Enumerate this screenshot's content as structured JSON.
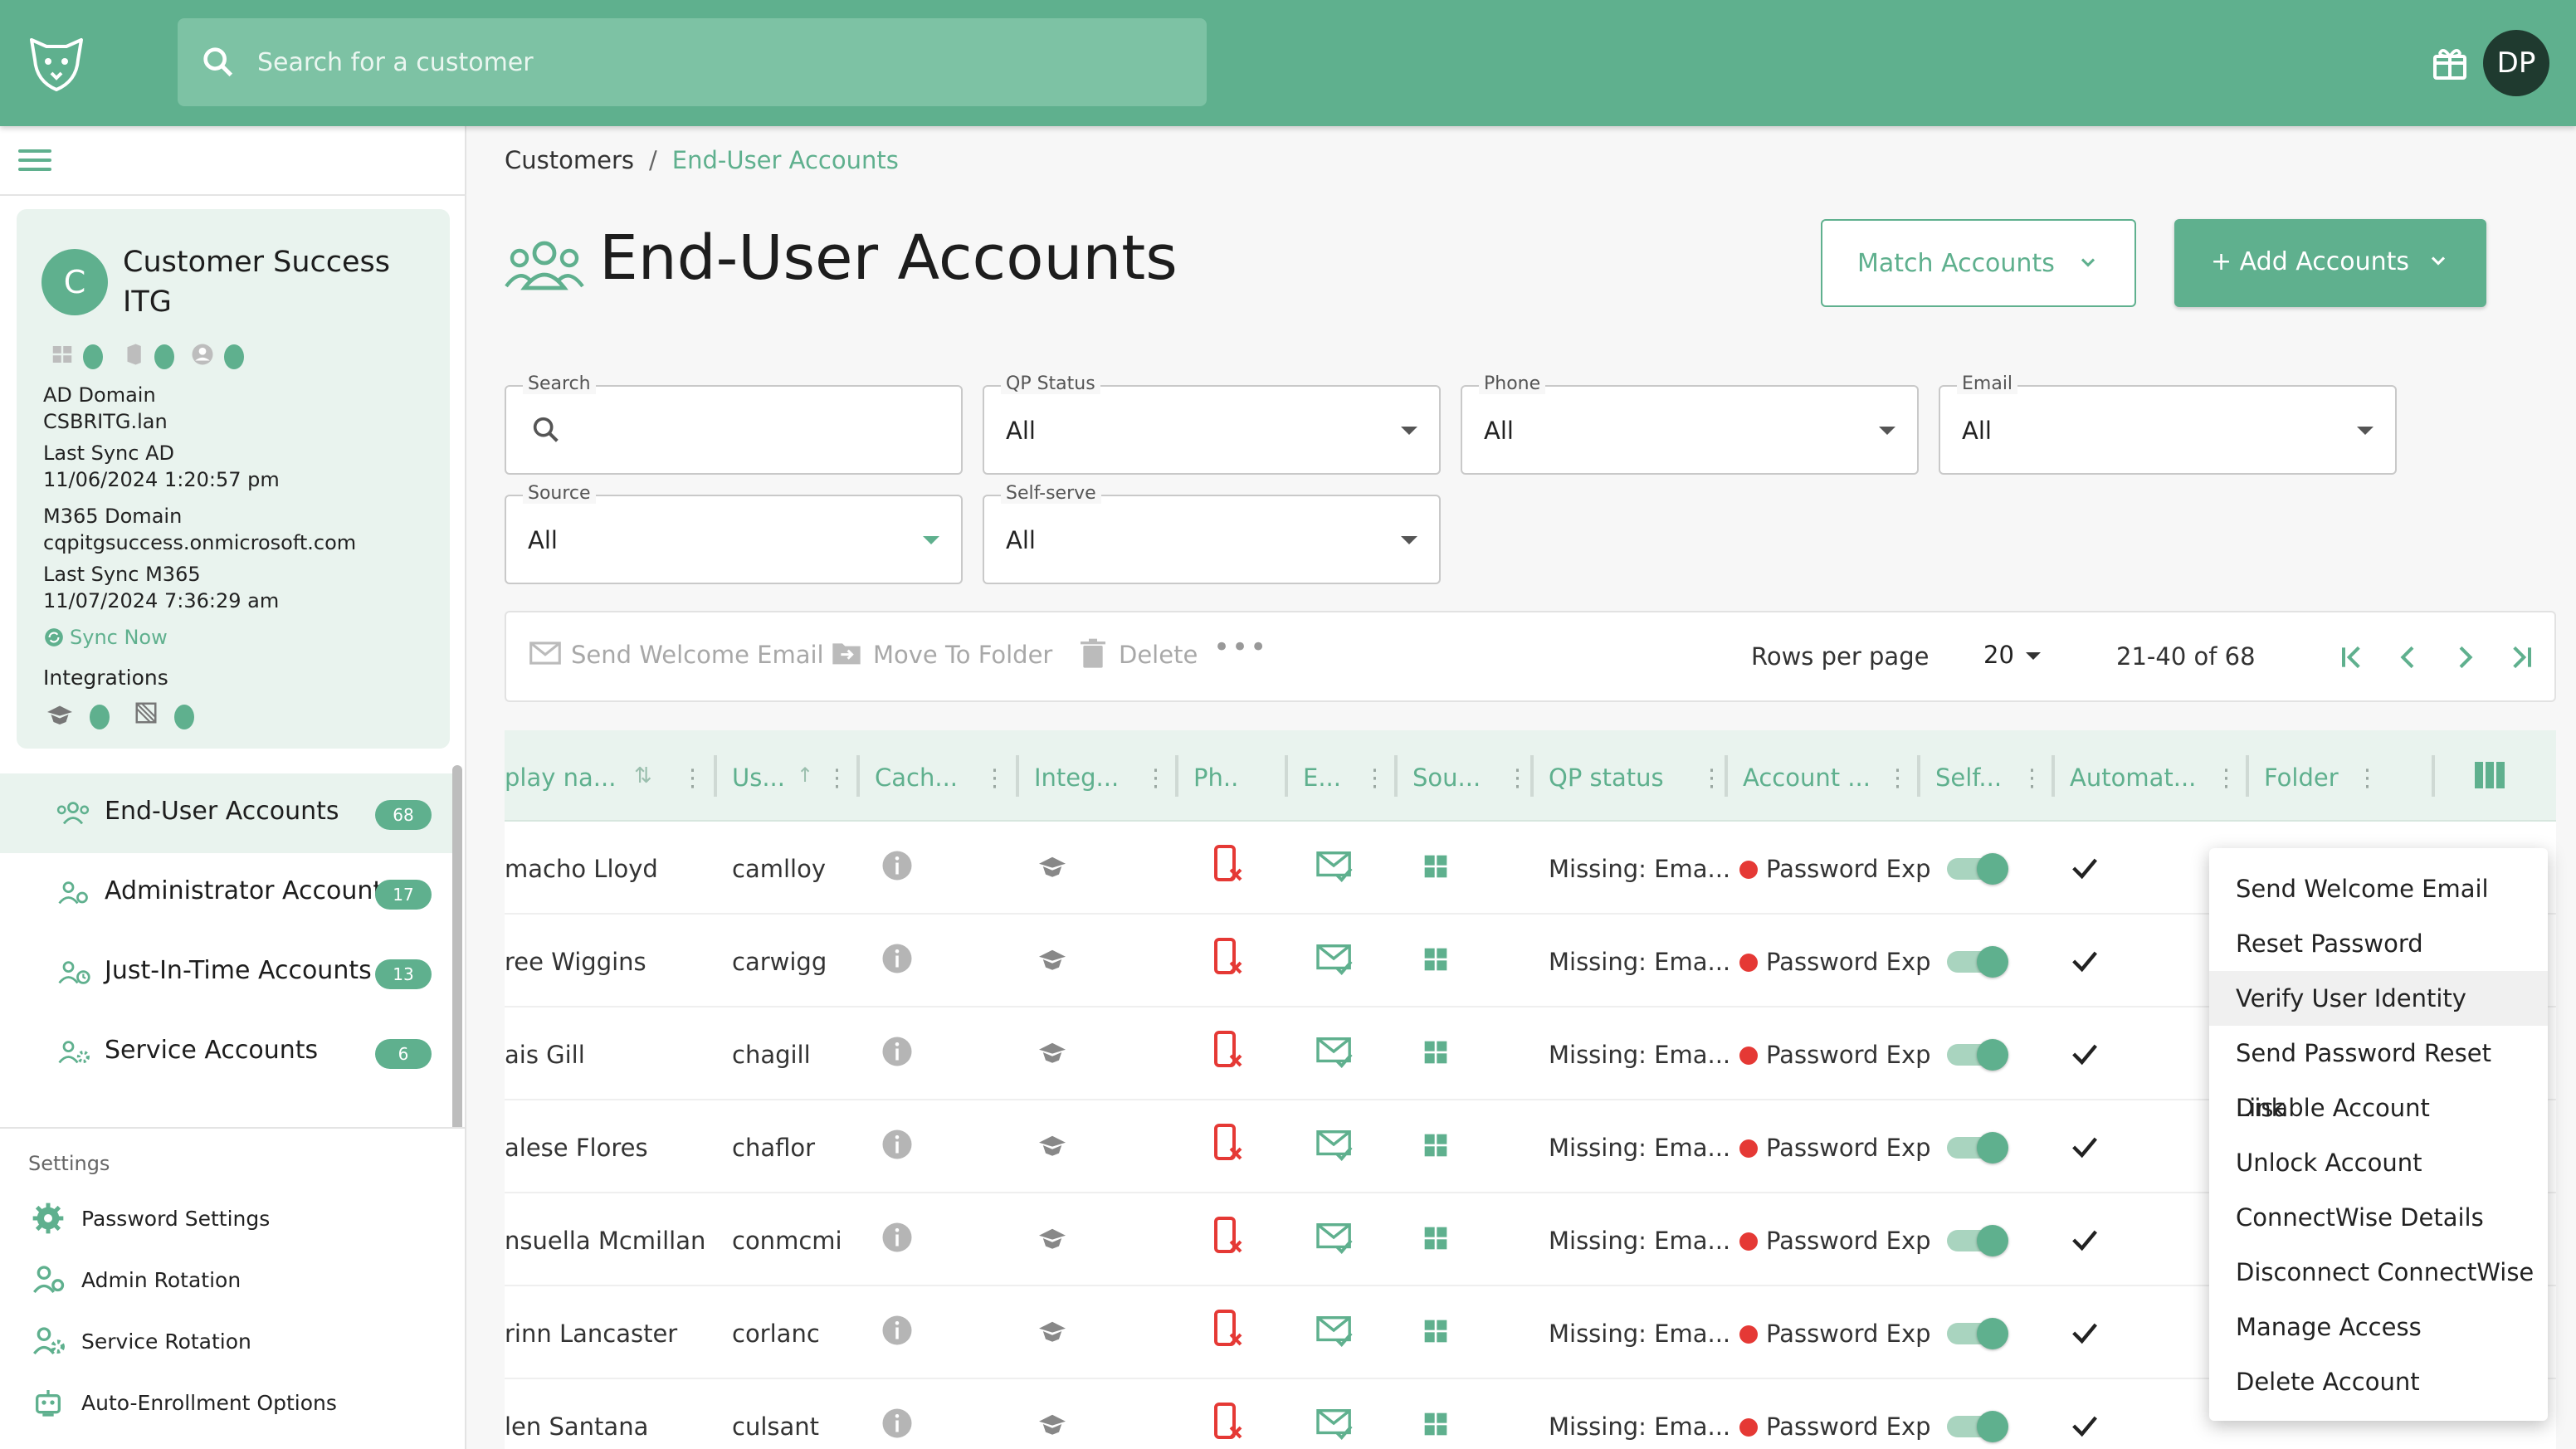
{
  "header": {
    "search_placeholder": "Search for a customer",
    "user_initials": "DP"
  },
  "customer": {
    "initial": "C",
    "name": "Customer Success ITG",
    "ad_domain_label": "AD Domain",
    "ad_domain": "CSBRITG.lan",
    "last_sync_ad_label": "Last Sync AD",
    "last_sync_ad": "11/06/2024 1:20:57 pm",
    "m365_domain_label": "M365 Domain",
    "m365_domain": "cqpitgsuccess.onmicrosoft.com",
    "last_sync_m365_label": "Last Sync M365",
    "last_sync_m365": "11/07/2024 7:36:29 am",
    "sync_now": "Sync Now",
    "integrations_label": "Integrations"
  },
  "nav": [
    {
      "label": "End-User Accounts",
      "count": "68"
    },
    {
      "label": "Administrator Accounts",
      "count": "17"
    },
    {
      "label": "Just-In-Time Accounts",
      "count": "13"
    },
    {
      "label": "Service Accounts",
      "count": "6"
    }
  ],
  "settings": {
    "title": "Settings",
    "items": [
      "Password Settings",
      "Admin Rotation",
      "Service Rotation",
      "Auto-Enrollment Options"
    ]
  },
  "breadcrumb": {
    "root": "Customers",
    "separator": "/",
    "current": "End-User Accounts"
  },
  "page": {
    "title": "End-User Accounts",
    "match_accounts": "Match Accounts",
    "add_accounts": "+ Add Accounts"
  },
  "filters": {
    "search_label": "Search",
    "qp_status_label": "QP Status",
    "qp_status": "All",
    "phone_label": "Phone",
    "phone": "All",
    "email_label": "Email",
    "email": "All",
    "source_label": "Source",
    "source": "All",
    "selfserve_label": "Self-serve",
    "selfserve": "All"
  },
  "toolbar": {
    "send_welcome": "Send Welcome Email",
    "move_to_folder": "Move To Folder",
    "delete": "Delete",
    "rows_per_page_label": "Rows per page",
    "rows_per_page": "20",
    "range": "21-40 of 68"
  },
  "columns": [
    "play na...",
    "Us...",
    "Cach...",
    "Integ...",
    "Ph..",
    "E...",
    "Sou...",
    "QP status",
    "Account ...",
    "Self...",
    "Automat...",
    "Folder"
  ],
  "rows": [
    {
      "name": "macho Lloyd",
      "user": "camlloy",
      "qp": "Missing: Ema...",
      "account": "Password Exp"
    },
    {
      "name": "ree Wiggins",
      "user": "carwigg",
      "qp": "Missing: Ema...",
      "account": "Password Exp"
    },
    {
      "name": "ais Gill",
      "user": "chagill",
      "qp": "Missing: Ema...",
      "account": "Password Exp"
    },
    {
      "name": "alese Flores",
      "user": "chaflor",
      "qp": "Missing: Ema...",
      "account": "Password Exp"
    },
    {
      "name": "nsuella Mcmillan",
      "user": "conmcmi",
      "qp": "Missing: Ema...",
      "account": "Password Exp"
    },
    {
      "name": "rinn Lancaster",
      "user": "corlanc",
      "qp": "Missing: Ema...",
      "account": "Password Exp"
    },
    {
      "name": "len Santana",
      "user": "culsant",
      "qp": "Missing: Ema...",
      "account": "Password Exp"
    }
  ],
  "context_menu": [
    "Send Welcome Email",
    "Reset Password",
    "Verify User Identity",
    "Send Password Reset Link",
    "Disable Account",
    "Unlock Account",
    "ConnectWise Details",
    "Disconnect ConnectWise",
    "Manage Access",
    "Delete Account"
  ],
  "colors": {
    "brand": "#5fb08e",
    "error": "#e53935"
  }
}
